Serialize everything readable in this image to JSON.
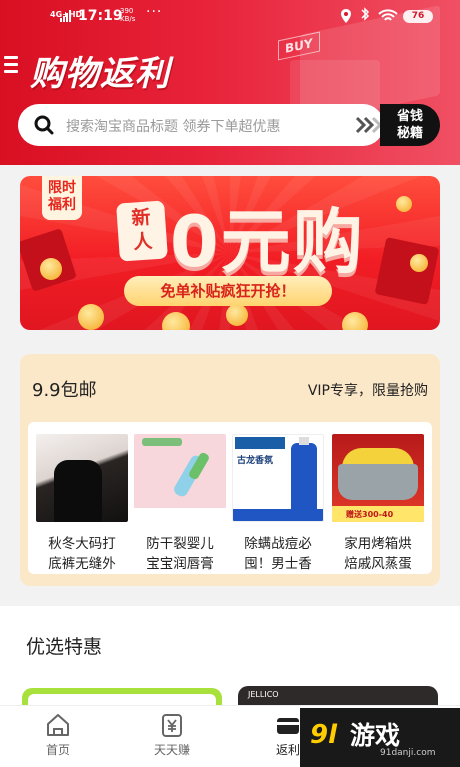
{
  "status": {
    "network": "4G+HD",
    "time": "17:19",
    "speed_value": "390",
    "speed_unit": "KB/s",
    "more": "···",
    "battery": "76"
  },
  "header": {
    "title": "购物返利",
    "buy_sign": "BUY",
    "search_placeholder": "搜索淘宝商品标题 领券下单超优惠",
    "tips_line1": "省钱",
    "tips_line2": "秘籍"
  },
  "banner": {
    "badge_line1": "限时",
    "badge_line2": "福利",
    "newbie_line1": "新",
    "newbie_line2": "人",
    "headline": "0元购",
    "subline": "免单补贴疯狂开抢！"
  },
  "deal_card": {
    "title": "9.9包邮",
    "subtitle": "VIP专享，限量抢购",
    "products": [
      {
        "line1": "秋冬大码打",
        "line2": "底裤无缝外"
      },
      {
        "line1": "防干裂婴儿",
        "line2": "宝宝润唇膏"
      },
      {
        "line1": "除螨战痘必",
        "line2": "囤！男士香"
      },
      {
        "line1": "家用烤箱烘",
        "line2": "焙戚风蒸蛋"
      }
    ],
    "p3_label": "古龙香氛",
    "p4_label": "赠送300-40"
  },
  "section": {
    "title": "优选特惠",
    "peek_brand": "JELLICO"
  },
  "tabbar": {
    "tabs": [
      {
        "label": "首页"
      },
      {
        "label": "天天赚"
      },
      {
        "label": "返利"
      }
    ]
  },
  "watermark": {
    "brand": "游戏",
    "logo": "9l",
    "site": "91danji.com"
  }
}
